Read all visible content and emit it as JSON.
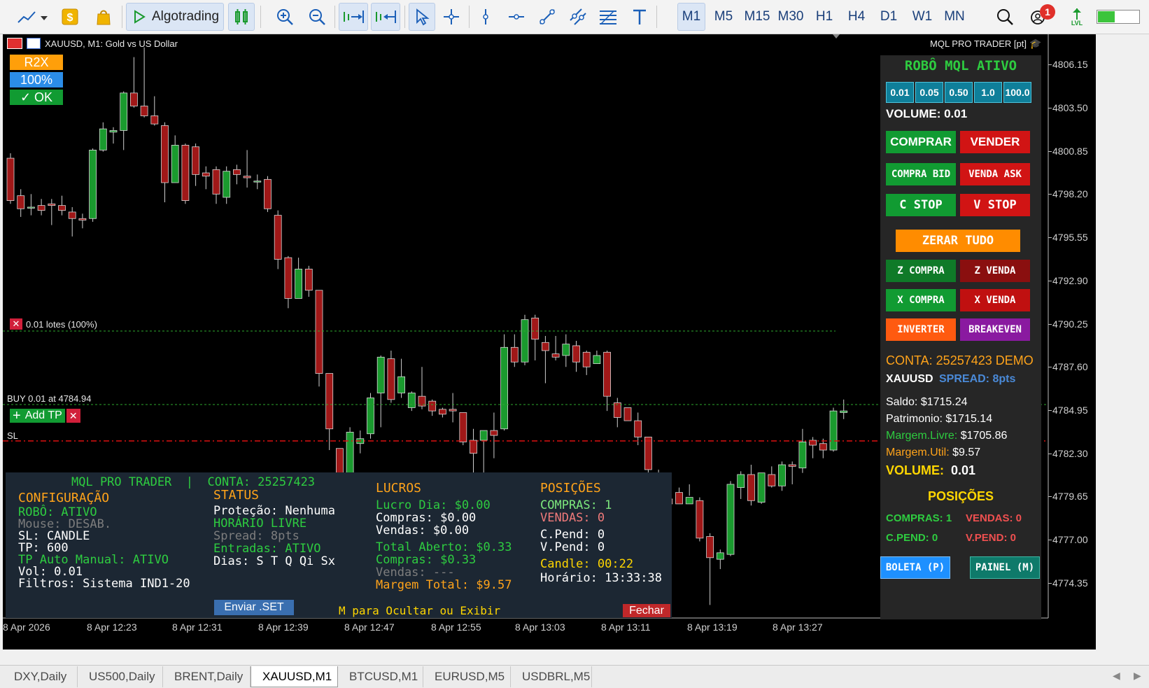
{
  "toolbar": {
    "algotrading_label": "Algotrading",
    "timeframes": [
      "M1",
      "M5",
      "M15",
      "M30",
      "H1",
      "H4",
      "D1",
      "W1",
      "MN"
    ],
    "active_timeframe": "M1",
    "notification_count": "1",
    "lvl_label": "LVL"
  },
  "chart": {
    "symbol_title": "XAUUSD, M1:  Gold vs US Dollar",
    "indicator_title": "MQL PRO TRADER [pt]",
    "top_buttons": {
      "r2x": "R2X",
      "pct": "100%",
      "ok": "✓ OK"
    },
    "line_label_lots": "0.01 lotes (100%)",
    "line_label_buy": "BUY 0.01 at 4784.94",
    "line_label_add_tp": "Add TP",
    "line_label_sl": "SL",
    "price_axis": [
      "4806.15",
      "4803.50",
      "4800.85",
      "4798.20",
      "4795.55",
      "4792.90",
      "4790.25",
      "4787.60",
      "4784.95",
      "4782.30",
      "4779.65",
      "4777.00",
      "4774.35"
    ],
    "time_axis": [
      "8 Apr 2026",
      "8 Apr 12:23",
      "8 Apr 12:31",
      "8 Apr 12:39",
      "8 Apr 12:47",
      "8 Apr 12:55",
      "8 Apr 13:03",
      "8 Apr 13:11",
      "8 Apr 13:19",
      "8 Apr 13:27"
    ]
  },
  "chart_data": {
    "type": "candlestick",
    "title": "XAUUSD, M1:  Gold vs US Dollar",
    "xlabel": "",
    "ylabel": "",
    "ylim": [
      4772.2,
      4808.0
    ],
    "grid": false,
    "candles": [
      {
        "o": 4800.4,
        "h": 4800.7,
        "l": 4797.6,
        "c": 4797.8
      },
      {
        "o": 4798.1,
        "h": 4798.5,
        "l": 4796.8,
        "c": 4797.3
      },
      {
        "o": 4797.4,
        "h": 4798.2,
        "l": 4796.9,
        "c": 4797.4
      },
      {
        "o": 4797.5,
        "h": 4797.9,
        "l": 4796.9,
        "c": 4797.2
      },
      {
        "o": 4797.6,
        "h": 4797.9,
        "l": 4796.3,
        "c": 4797.5
      },
      {
        "o": 4797.5,
        "h": 4798.1,
        "l": 4796.9,
        "c": 4797.2
      },
      {
        "o": 4797.1,
        "h": 4797.4,
        "l": 4795.6,
        "c": 4796.7
      },
      {
        "o": 4796.7,
        "h": 4797.0,
        "l": 4796.1,
        "c": 4796.6
      },
      {
        "o": 4796.7,
        "h": 4801.0,
        "l": 4796.5,
        "c": 4800.9
      },
      {
        "o": 4800.9,
        "h": 4802.6,
        "l": 4800.8,
        "c": 4802.2
      },
      {
        "o": 4802.0,
        "h": 4802.3,
        "l": 4801.3,
        "c": 4802.1
      },
      {
        "o": 4802.1,
        "h": 4804.5,
        "l": 4800.9,
        "c": 4804.4
      },
      {
        "o": 4804.4,
        "h": 4806.6,
        "l": 4803.5,
        "c": 4803.6
      },
      {
        "o": 4803.6,
        "h": 4807.2,
        "l": 4802.9,
        "c": 4803.0
      },
      {
        "o": 4803.0,
        "h": 4804.2,
        "l": 4802.4,
        "c": 4802.5
      },
      {
        "o": 4802.4,
        "h": 4802.6,
        "l": 4797.7,
        "c": 4798.9
      },
      {
        "o": 4798.9,
        "h": 4801.8,
        "l": 4798.9,
        "c": 4801.2
      },
      {
        "o": 4801.2,
        "h": 4801.3,
        "l": 4797.6,
        "c": 4797.8
      },
      {
        "o": 4801.1,
        "h": 4801.3,
        "l": 4798.7,
        "c": 4799.4
      },
      {
        "o": 4799.5,
        "h": 4799.9,
        "l": 4798.5,
        "c": 4799.3
      },
      {
        "o": 4799.7,
        "h": 4799.9,
        "l": 4797.6,
        "c": 4798.2
      },
      {
        "o": 4798.0,
        "h": 4799.9,
        "l": 4797.6,
        "c": 4799.6
      },
      {
        "o": 4799.7,
        "h": 4800.0,
        "l": 4798.8,
        "c": 4799.4
      },
      {
        "o": 4799.3,
        "h": 4800.9,
        "l": 4798.6,
        "c": 4799.2
      },
      {
        "o": 4799.0,
        "h": 4799.4,
        "l": 4798.5,
        "c": 4799.0
      },
      {
        "o": 4799.1,
        "h": 4799.3,
        "l": 4797.1,
        "c": 4797.3
      },
      {
        "o": 4796.9,
        "h": 4797.2,
        "l": 4793.6,
        "c": 4794.2
      },
      {
        "o": 4794.3,
        "h": 4794.4,
        "l": 4791.2,
        "c": 4791.8
      },
      {
        "o": 4791.8,
        "h": 4794.3,
        "l": 4791.8,
        "c": 4793.6
      },
      {
        "o": 4793.6,
        "h": 4793.8,
        "l": 4791.9,
        "c": 4792.3
      },
      {
        "o": 4792.3,
        "h": 4792.3,
        "l": 4786.4,
        "c": 4787.2
      },
      {
        "o": 4787.2,
        "h": 4787.2,
        "l": 4782.5,
        "c": 4783.8
      },
      {
        "o": 4782.6,
        "h": 4782.6,
        "l": 4779.5,
        "c": 4779.6
      },
      {
        "o": 4780.8,
        "h": 4783.9,
        "l": 4779.8,
        "c": 4783.6
      },
      {
        "o": 4782.9,
        "h": 4783.7,
        "l": 4782.3,
        "c": 4783.2
      },
      {
        "o": 4783.5,
        "h": 4786.0,
        "l": 4783.2,
        "c": 4785.7
      },
      {
        "o": 4786.0,
        "h": 4788.3,
        "l": 4783.9,
        "c": 4788.2
      },
      {
        "o": 4788.1,
        "h": 4788.6,
        "l": 4785.4,
        "c": 4785.6
      },
      {
        "o": 4786.0,
        "h": 4788.1,
        "l": 4785.7,
        "c": 4787.0
      },
      {
        "o": 4785.1,
        "h": 4786.1,
        "l": 4784.9,
        "c": 4786.0
      },
      {
        "o": 4785.8,
        "h": 4787.6,
        "l": 4785.0,
        "c": 4785.2
      },
      {
        "o": 4785.5,
        "h": 4785.6,
        "l": 4784.6,
        "c": 4784.9
      },
      {
        "o": 4785.0,
        "h": 4785.1,
        "l": 4784.5,
        "c": 4784.7
      },
      {
        "o": 4785.0,
        "h": 4786.0,
        "l": 4784.2,
        "c": 4784.9
      },
      {
        "o": 4784.8,
        "h": 4784.8,
        "l": 4782.8,
        "c": 4783.0
      },
      {
        "o": 4783.1,
        "h": 4783.8,
        "l": 4780.6,
        "c": 4782.3
      },
      {
        "o": 4783.1,
        "h": 4783.7,
        "l": 4781.0,
        "c": 4783.7
      },
      {
        "o": 4783.7,
        "h": 4784.8,
        "l": 4782.0,
        "c": 4783.4
      },
      {
        "o": 4783.8,
        "h": 4789.6,
        "l": 4783.7,
        "c": 4788.8
      },
      {
        "o": 4788.8,
        "h": 4789.6,
        "l": 4787.6,
        "c": 4787.9
      },
      {
        "o": 4787.9,
        "h": 4790.8,
        "l": 4787.7,
        "c": 4790.5
      },
      {
        "o": 4790.6,
        "h": 4790.8,
        "l": 4788.0,
        "c": 4789.3
      },
      {
        "o": 4789.1,
        "h": 4789.5,
        "l": 4786.6,
        "c": 4788.6
      },
      {
        "o": 4788.4,
        "h": 4789.5,
        "l": 4788.0,
        "c": 4788.2
      },
      {
        "o": 4788.3,
        "h": 4789.6,
        "l": 4787.6,
        "c": 4789.0
      },
      {
        "o": 4788.9,
        "h": 4789.2,
        "l": 4787.3,
        "c": 4787.9
      },
      {
        "o": 4788.5,
        "h": 4788.6,
        "l": 4787.1,
        "c": 4787.6
      },
      {
        "o": 4787.8,
        "h": 4788.6,
        "l": 4787.8,
        "c": 4788.3
      },
      {
        "o": 4788.5,
        "h": 4788.6,
        "l": 4784.9,
        "c": 4785.8
      },
      {
        "o": 4785.4,
        "h": 4785.7,
        "l": 4783.9,
        "c": 4784.5
      },
      {
        "o": 4785.1,
        "h": 4785.1,
        "l": 4784.4,
        "c": 4784.3
      },
      {
        "o": 4784.3,
        "h": 4784.8,
        "l": 4782.8,
        "c": 4783.3
      },
      {
        "o": 4783.3,
        "h": 4783.3,
        "l": 4780.5,
        "c": 4781.3
      },
      {
        "o": 4781.1,
        "h": 4781.3,
        "l": 4779.7,
        "c": 4779.8
      },
      {
        "o": 4779.5,
        "h": 4779.6,
        "l": 4777.3,
        "c": 4779.2
      },
      {
        "o": 4779.9,
        "h": 4780.2,
        "l": 4779.2,
        "c": 4779.2
      },
      {
        "o": 4779.2,
        "h": 4779.7,
        "l": 4780.4,
        "c": 4779.6
      },
      {
        "o": 4779.4,
        "h": 4779.6,
        "l": 4776.9,
        "c": 4777.1
      },
      {
        "o": 4777.2,
        "h": 4777.4,
        "l": 4773.0,
        "c": 4775.9
      },
      {
        "o": 4775.8,
        "h": 4776.4,
        "l": 4775.2,
        "c": 4776.2
      },
      {
        "o": 4776.1,
        "h": 4780.6,
        "l": 4776.0,
        "c": 4780.4
      },
      {
        "o": 4780.2,
        "h": 4781.2,
        "l": 4779.5,
        "c": 4781.0
      },
      {
        "o": 4781.0,
        "h": 4781.6,
        "l": 4779.1,
        "c": 4779.4
      },
      {
        "o": 4779.3,
        "h": 4781.1,
        "l": 4779.2,
        "c": 4781.1
      },
      {
        "o": 4781.0,
        "h": 4781.5,
        "l": 4780.2,
        "c": 4780.3
      },
      {
        "o": 4780.3,
        "h": 4781.8,
        "l": 4780.0,
        "c": 4781.6
      },
      {
        "o": 4781.6,
        "h": 4781.8,
        "l": 4780.4,
        "c": 4781.5
      },
      {
        "o": 4781.4,
        "h": 4783.8,
        "l": 4781.1,
        "c": 4783.0
      },
      {
        "o": 4783.1,
        "h": 4783.3,
        "l": 4782.0,
        "c": 4782.8
      },
      {
        "o": 4782.9,
        "h": 4783.2,
        "l": 4782.0,
        "c": 4782.5
      },
      {
        "o": 4782.5,
        "h": 4785.1,
        "l": 4782.4,
        "c": 4784.9
      },
      {
        "o": 4784.8,
        "h": 4785.6,
        "l": 4784.4,
        "c": 4784.9
      }
    ]
  },
  "right_panel": {
    "title": "ROBÔ MQL ATIVO",
    "volume_options": [
      "0.01",
      "0.05",
      "0.50",
      "1.0",
      "100.0"
    ],
    "volume_label": "VOLUME: 0.01",
    "buttons": {
      "comprar": "COMPRAR",
      "vender": "VENDER",
      "compra_bid": "COMPRA BID",
      "venda_ask": "VENDA ASK",
      "c_stop": "C STOP",
      "v_stop": "V STOP",
      "zerar_tudo": "ZERAR TUDO",
      "z_compra": "Z COMPRA",
      "z_venda": "Z VENDA",
      "x_compra": "X COMPRA",
      "x_venda": "X VENDA",
      "inverter": "INVERTER",
      "breakeven": "BREAKEVEN",
      "boleta": "BOLETA (P)",
      "painel": "PAINEL (M)"
    },
    "conta": "CONTA: 25257423 DEMO",
    "symbol": "XAUUSD",
    "spread": "SPREAD: 8pts",
    "saldo": "Saldo: $1715.24",
    "patrimonio": "Patrimonio: $1715.14",
    "margem_livre_label": "Margem.Livre:",
    "margem_livre_value": "$1705.86",
    "margem_util_label": "Margem.Util:",
    "margem_util_value": "$9.57",
    "volume_big_label": "VOLUME:",
    "volume_big_value": "0.01",
    "posicoes_title": "POSIÇÕES",
    "compras": "COMPRAS: 1",
    "vendas": "VENDAS: 0",
    "cpend": "C.PEND: 0",
    "vpend": "V.PEND: 0"
  },
  "info_panel": {
    "header_title": "MQL PRO TRADER",
    "header_sep": "|",
    "header_conta": "CONTA: 25257423",
    "config": {
      "title": "CONFIGURAÇÃO",
      "robo": "ROBÔ: ATIVO",
      "mouse": "Mouse: DESAB.",
      "sl": "SL: CANDLE",
      "tp": "TP: 600",
      "tp_auto": "TP Auto Manual: ATIVO",
      "vol": "Vol: 0.01",
      "filtros": "Filtros: Sistema IND1-20"
    },
    "status": {
      "title": "STATUS",
      "protecao": "Proteção: Nenhuma",
      "horario": "HORÁRIO LIVRE",
      "spread": "Spread: 8pts",
      "entradas": "Entradas: ATIVO",
      "dias": "Dias: S T Q Qi Sx"
    },
    "lucros": {
      "title": "LUCROS",
      "lucro_dia": "Lucro Dia: $0.00",
      "compras": "Compras: $0.00",
      "vendas": "Vendas: $0.00",
      "total_aberto": "Total Aberto: $0.33",
      "compras2": "Compras: $0.33",
      "vendas2": "Vendas: ---",
      "margem_total": "Margem Total: $9.57"
    },
    "posicoes": {
      "title": "POSIÇÕES",
      "compras": "COMPRAS: 1",
      "vendas": "VENDAS: 0",
      "cpend": "C.Pend: 0",
      "vpend": "V.Pend: 0",
      "candle": "Candle: 00:22",
      "horario": "Horário: 13:33:38"
    },
    "enviar": "Enviar .SET",
    "hint": "M para Ocultar ou Exibir",
    "fechar": "Fechar"
  },
  "tabs": [
    "DXY,Daily",
    "US500,Daily",
    "BRENT,Daily",
    "XAUUSD,M1",
    "BTCUSD,M1",
    "EURUSD,M5",
    "USDBRL,M5"
  ],
  "active_tab": "XAUUSD,M1",
  "colors": {
    "bull": "#1a9a2e",
    "bear": "#a01818",
    "panel_bg": "#262626",
    "green_text": "#2ecc40",
    "orange_text": "#ffa31a",
    "yellow_text": "#ffd600"
  }
}
